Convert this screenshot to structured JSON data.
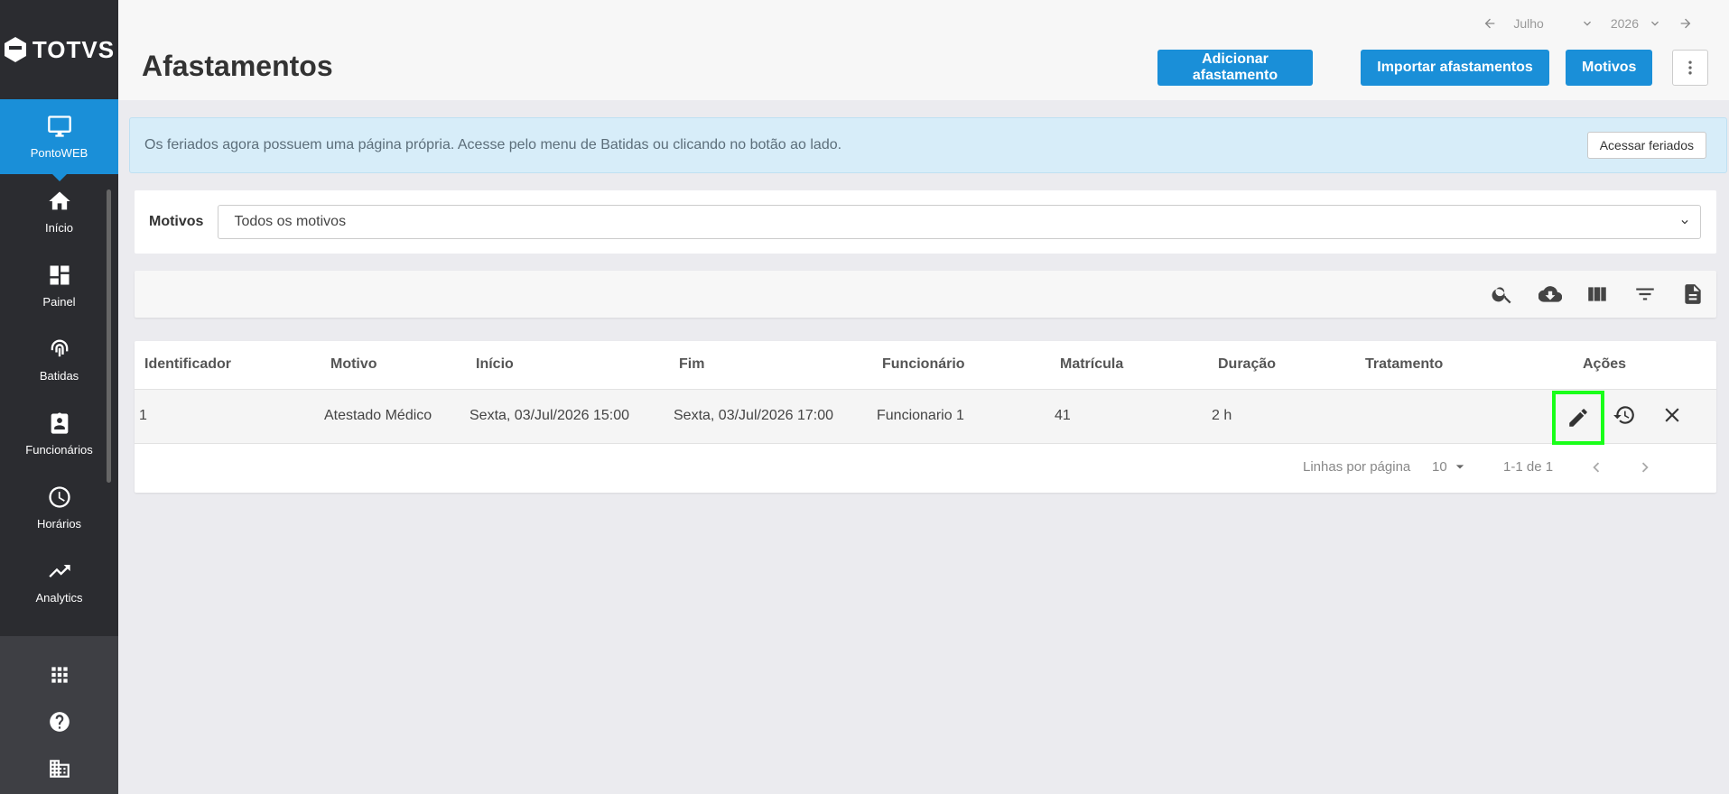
{
  "brand": {
    "name": "TOTVS"
  },
  "sidebar": {
    "items": [
      {
        "label": "PontoWEB",
        "icon": "monitor-icon",
        "active": true
      },
      {
        "label": "Início",
        "icon": "home-icon"
      },
      {
        "label": "Painel",
        "icon": "dashboard-icon"
      },
      {
        "label": "Batidas",
        "icon": "fingerprint-icon"
      },
      {
        "label": "Funcionários",
        "icon": "badge-icon"
      },
      {
        "label": "Horários",
        "icon": "clock-icon"
      },
      {
        "label": "Analytics",
        "icon": "trending-up-icon"
      }
    ],
    "bottom_icons": [
      "apps-grid-icon",
      "help-icon",
      "company-icon"
    ]
  },
  "header": {
    "title": "Afastamentos",
    "month": "Julho",
    "year": "2026",
    "buttons": {
      "add": "Adicionar afastamento",
      "import": "Importar afastamentos",
      "reasons": "Motivos"
    }
  },
  "alert": {
    "text": "Os feriados agora possuem uma página própria. Acesse pelo menu de Batidas ou clicando no botão ao lado.",
    "button": "Acessar feriados"
  },
  "filter": {
    "label": "Motivos",
    "selected": "Todos os motivos"
  },
  "toolbar": {
    "icons": [
      "search-icon",
      "cloud-download-icon",
      "columns-icon",
      "filter-icon",
      "document-icon"
    ]
  },
  "table": {
    "columns": [
      "Identificador",
      "Motivo",
      "Início",
      "Fim",
      "Funcionário",
      "Matrícula",
      "Duração",
      "Tratamento",
      "Ações"
    ],
    "rows": [
      {
        "identificador": "1",
        "motivo": "Atestado Médico",
        "inicio": "Sexta, 03/Jul/2026 15:00",
        "fim": "Sexta, 03/Jul/2026 17:00",
        "funcionario": "Funcionario 1",
        "matricula": "41",
        "duracao": "2 h",
        "tratamento": ""
      }
    ],
    "pagination": {
      "rows_label": "Linhas por página",
      "rows_per_page": "10",
      "range": "1-1 de 1"
    }
  },
  "colors": {
    "primary": "#1a8fd8",
    "sidebar": "#2b2c30",
    "highlight": "#19ff19"
  }
}
